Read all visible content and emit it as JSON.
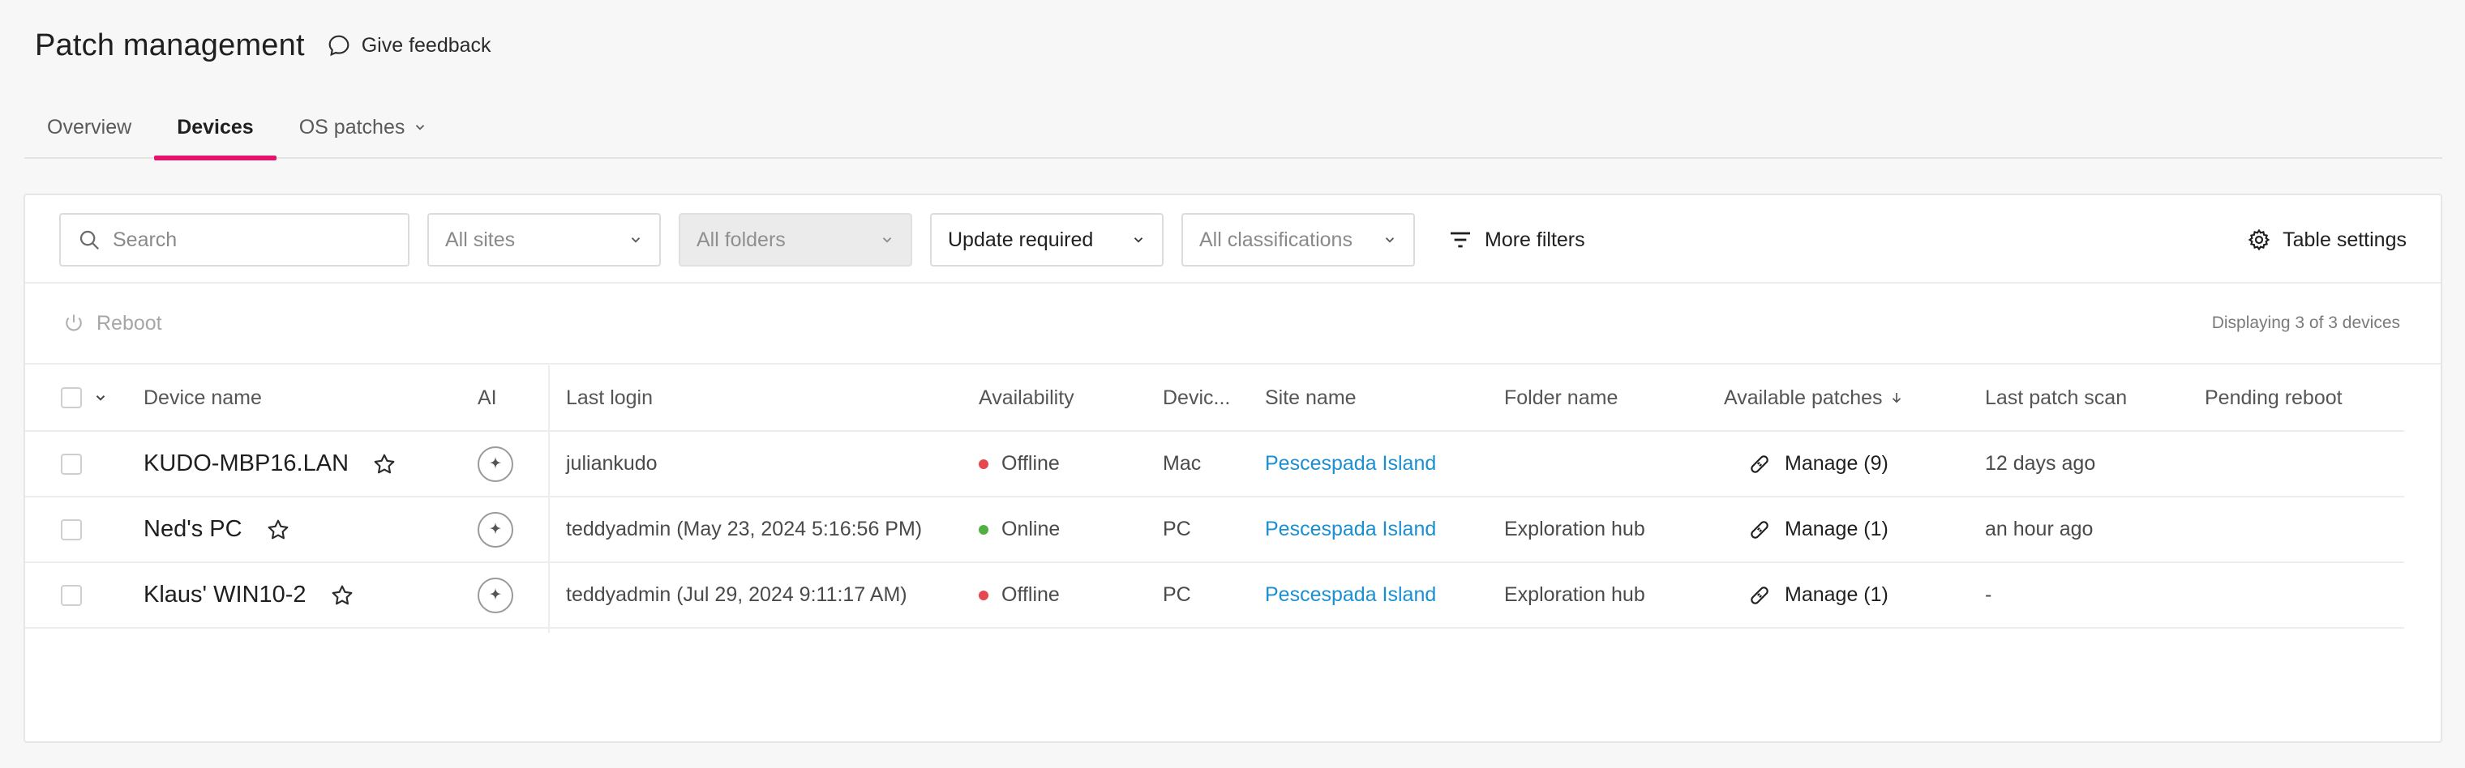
{
  "header": {
    "title": "Patch management",
    "feedback_label": "Give feedback"
  },
  "tabs": [
    {
      "label": "Overview"
    },
    {
      "label": "Devices"
    },
    {
      "label": "OS patches"
    }
  ],
  "filters": {
    "search_placeholder": "Search",
    "sites": "All sites",
    "folders": "All folders",
    "status": "Update required",
    "classifications": "All classifications",
    "more_filters": "More filters",
    "table_settings": "Table settings"
  },
  "actions": {
    "reboot": "Reboot",
    "display_count": "Displaying 3 of 3 devices"
  },
  "columns": {
    "device_name": "Device name",
    "ai": "AI",
    "last_login": "Last login",
    "availability": "Availability",
    "device_type": "Devic...",
    "site_name": "Site name",
    "folder_name": "Folder name",
    "available_patches": "Available patches",
    "last_patch_scan": "Last patch scan",
    "pending_reboot": "Pending reboot"
  },
  "rows": [
    {
      "name": "KUDO-MBP16.LAN",
      "last_login": "juliankudo",
      "availability": "Offline",
      "type": "Mac",
      "site": "Pescespada Island",
      "folder": "",
      "patches": "Manage (9)",
      "scan": "12 days ago"
    },
    {
      "name": "Ned's PC",
      "last_login": "teddyadmin (May 23, 2024 5:16:56 PM)",
      "availability": "Online",
      "type": "PC",
      "site": "Pescespada Island",
      "folder": "Exploration hub",
      "patches": "Manage (1)",
      "scan": "an hour ago"
    },
    {
      "name": "Klaus' WIN10-2",
      "last_login": "teddyadmin (Jul 29, 2024 9:11:17 AM)",
      "availability": "Offline",
      "type": "PC",
      "site": "Pescespada Island",
      "folder": "Exploration hub",
      "patches": "Manage (1)",
      "scan": "-"
    }
  ],
  "colors": {
    "accent": "#e6136c",
    "link": "#1a8fd1",
    "offline": "#e5484d",
    "online": "#52b043"
  },
  "icons": {
    "feedback": "chat-bubble-icon",
    "search": "search-icon",
    "filter": "filter-lines-icon",
    "settings": "gear-icon",
    "reboot": "power-icon",
    "ai": "sparkle-icon",
    "favorite": "star-icon",
    "patch": "bandage-icon",
    "sort": "arrow-down-icon"
  }
}
